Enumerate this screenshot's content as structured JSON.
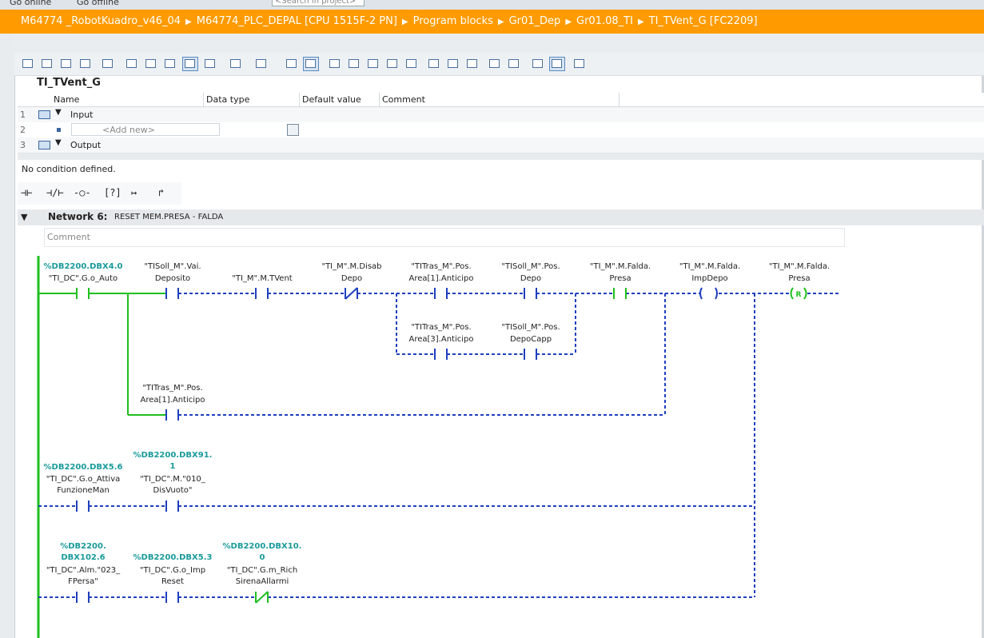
{
  "topbar": {
    "go_offline_1": "Go online",
    "go_offline_2": "Go offline",
    "search_placeholder": "<Search in project>"
  },
  "breadcrumb": [
    "M64774 _RobotKuadro_v46_04",
    "M64774_PLC_DEPAL [CPU 1515F-2 PN]",
    "Program blocks",
    "Gr01_Dep",
    "Gr01.08_TI",
    "TI_TVent_G [FC2209]"
  ],
  "block_title": "TI_TVent_G",
  "interface": {
    "columns": [
      "Name",
      "Data type",
      "Default value",
      "Comment"
    ],
    "rows": [
      {
        "num": "1",
        "name": "Input"
      },
      {
        "num": "2",
        "name": "<Add new>"
      },
      {
        "num": "3",
        "name": "Output"
      }
    ]
  },
  "condition_text": "No condition defined.",
  "network": {
    "title": "Network 6:",
    "description": "RESET MEM.PRESA - FALDA",
    "comment_placeholder": "Comment"
  },
  "ladder": {
    "row1": [
      {
        "addr": "%DB2200.DBX4.0",
        "l1": "\"TI_DC\".G.o_Auto",
        "l2": ""
      },
      {
        "addr": "",
        "l1": "\"TISoll_M\".Vai.",
        "l2": "Deposito"
      },
      {
        "addr": "",
        "l1": "",
        "l2": "\"TI_M\".M.TVent"
      },
      {
        "addr": "",
        "l1": "\"TI_M\".M.Disab",
        "l2": "Depo"
      },
      {
        "addr": "",
        "l1": "\"TITras_M\".Pos.",
        "l2": "Area[1].Anticipo"
      },
      {
        "addr": "",
        "l1": "\"TISoll_M\".Pos.",
        "l2": "Depo"
      },
      {
        "addr": "",
        "l1": "\"TI_M\".M.Falda.",
        "l2": "Presa"
      },
      {
        "addr": "",
        "l1": "\"TI_M\".M.Falda.",
        "l2": "ImpDepo"
      },
      {
        "addr": "",
        "l1": "\"TI_M\".M.Falda.",
        "l2": "Presa"
      }
    ],
    "row2": [
      {
        "l1": "\"TITras_M\".Pos.",
        "l2": "Area[3].Anticipo"
      },
      {
        "l1": "\"TISoll_M\".Pos.",
        "l2": "DepoCapp"
      }
    ],
    "row3": [
      {
        "l1": "\"TITras_M\".Pos.",
        "l2": "Area[1].Anticipo"
      }
    ],
    "row4": [
      {
        "addr": "%DB2200.DBX5.6",
        "l1": "\"TI_DC\".G.o_Attiva",
        "l2": "FunzioneMan"
      },
      {
        "addr1": "%DB2200.DBX91.",
        "addr2": "1",
        "l1": "\"TI_DC\".M.\"010_",
        "l2": "DisVuoto\""
      }
    ],
    "row5": [
      {
        "addr1": "%DB2200.",
        "addr2": "DBX102.6",
        "l1": "\"TI_DC\".Alm.\"023_",
        "l2": "FPersa\""
      },
      {
        "addr": "%DB2200.DBX5.3",
        "l1": "\"TI_DC\".G.o_Imp",
        "l2": "Reset"
      },
      {
        "addr1": "%DB2200.DBX10.",
        "addr2": "0",
        "l1": "\"TI_DC\".G.m_Rich",
        "l2": "SirenaAllarmi"
      }
    ],
    "reset_coil_label": "R"
  },
  "colors": {
    "accent": "#ff9b00",
    "energized": "#1fbf1f",
    "deenergized": "#1f3fbf",
    "address": "#1a9a9a"
  }
}
